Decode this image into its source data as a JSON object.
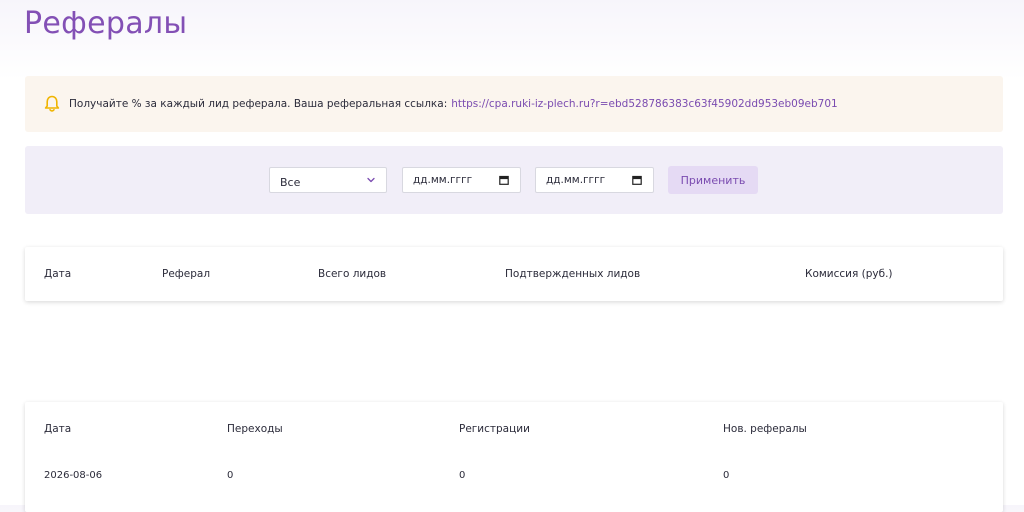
{
  "page": {
    "title": "Рефералы"
  },
  "alert": {
    "text": "Получайте % за каждый лид реферала. Ваша реферальная ссылка:",
    "link": "https://cpa.ruki-iz-plech.ru?r=ebd528786383c63f45902dd953eb09eb701",
    "icon": "bell-icon",
    "icon_color": "#f0b400"
  },
  "filter": {
    "select_value": "Все",
    "date_from_placeholder": "дд.мм.гггг",
    "date_to_placeholder": "дд.мм.гггг",
    "apply_label": "Применить"
  },
  "referrals_table": {
    "headers": [
      "Дата",
      "Реферал",
      "Всего лидов",
      "Подтвержденных лидов",
      "Комиссия (руб.)"
    ],
    "rows": []
  },
  "stats_table": {
    "headers": [
      "Дата",
      "Переходы",
      "Регистрации",
      "Нов. рефералы"
    ],
    "rows": [
      [
        "2026-08-06",
        "0",
        "0",
        "0"
      ]
    ]
  },
  "colors": {
    "accent": "#8350b5",
    "alert_bg": "#fbf5ee",
    "filter_bg": "#f1eef8",
    "button_bg": "#e5daf4"
  }
}
